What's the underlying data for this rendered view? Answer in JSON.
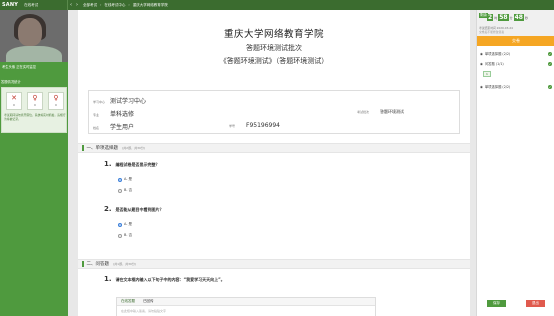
{
  "topbar": {
    "brand": "SANY",
    "product": "在线考试",
    "crumbs": [
      "全部考试",
      "在线考试中心",
      "重庆大学网络教育学院"
    ],
    "user": "重庆大学网络教育学院",
    "right_icons": [
      "minimize-icon",
      "maximize-icon",
      "close-icon"
    ]
  },
  "left": {
    "camera_label": "考生头像 正在实时监控",
    "stats_title": "答题情况统计",
    "stats": [
      {
        "icon": "cross-icon",
        "glyph": "✕",
        "value": "0"
      },
      {
        "icon": "person-icon",
        "glyph": "♀",
        "value": "0"
      },
      {
        "icon": "person-icon",
        "glyph": "♀",
        "value": "0"
      }
    ],
    "stats_note": "考试期间请勿离开座位，系统将实时抓拍，违规行为将被记录。"
  },
  "main": {
    "school": "重庆大学网络教育学院",
    "batch": "答题环境测试批次",
    "paper": "《答题环境测试》（答题环境测试）",
    "info": {
      "center_label": "学习中心",
      "center_value": "测试学习中心",
      "level_label": "专业",
      "level_value": "单科选修",
      "name_label": "姓名",
      "name_value": "学生用户",
      "id_label": "学号",
      "id_value": "F95196994",
      "batch_label": "考试批次",
      "batch_value": "答题环境测试"
    },
    "sections": [
      {
        "title": "一、单项选择题",
        "meta": "(共2题，共30分)"
      },
      {
        "title": "二、问答题",
        "meta": "(共1题，共30分)"
      }
    ],
    "questions": [
      {
        "num": "1.",
        "text": "编程试卷是否显示完整？",
        "options": [
          {
            "label": "A. 是",
            "checked": true
          },
          {
            "label": "B. 否",
            "checked": false
          }
        ]
      },
      {
        "num": "2.",
        "text": "是否能从题目中看到图片？",
        "options": [
          {
            "label": "A. 是",
            "checked": true
          },
          {
            "label": "B. 否",
            "checked": false
          }
        ]
      },
      {
        "num": "1.",
        "text": "请在文本框内输入以下句子中的内容：“我爱学习天天向上”。"
      }
    ],
    "editor": {
      "tab_text": "在线答题",
      "tab_upload": "已回传",
      "placeholder": "在此框中输入答案，请勿粘贴文字"
    }
  },
  "right": {
    "timer_label": "剩余",
    "timer": {
      "h": "2",
      "h_unit": "时",
      "m": "58",
      "m_unit": "分",
      "s": "48",
      "s_unit": "秒"
    },
    "timer_sub": "考试结束时间 2020-03-24",
    "timer_sub2": "交卷后不能修改答案",
    "submit": "交卷",
    "items": [
      {
        "label": "单项选择题 (2/2)",
        "icon": "check-icon"
      },
      {
        "label": "问答题 (1/1)",
        "icon": "check-icon"
      },
      {
        "label": "单项选择题 (2/2)",
        "icon": "check-icon"
      }
    ],
    "chip": "1",
    "btn_save": "保存",
    "btn_exit": "退出"
  },
  "colors": {
    "brand_green": "#4f9a3e",
    "dark_green": "#3b6c2f",
    "accent_orange": "#f5a623",
    "radio_blue": "#3b7fd9"
  }
}
